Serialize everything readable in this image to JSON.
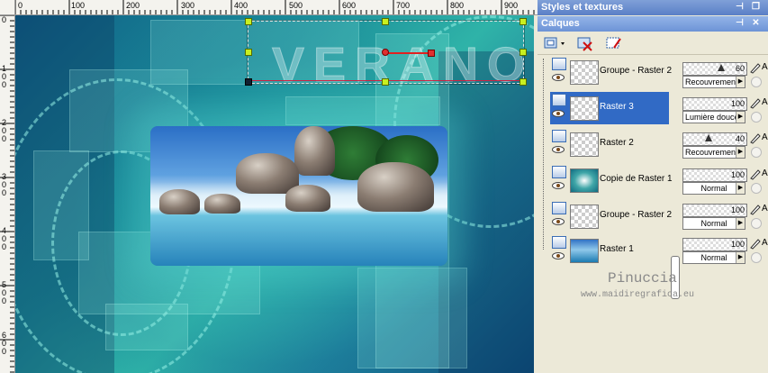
{
  "rulers": {
    "top_labels": [
      "0",
      "100",
      "200",
      "300",
      "400",
      "500",
      "600",
      "700",
      "800",
      "900"
    ],
    "left_labels": [
      "0",
      "1 0 0",
      "2 0 0",
      "3 0 0",
      "4 0 0",
      "5 0 0",
      "6 0 0",
      "7 0 0"
    ]
  },
  "canvas": {
    "watermark_text": "VERANO"
  },
  "panels": {
    "styles_title": "Styles et textures",
    "layers_title": "Calques"
  },
  "layers": [
    {
      "name": "Groupe - Raster 2",
      "thumb": "transparent",
      "selected": false
    },
    {
      "name": "Raster 3",
      "thumb": "transparent",
      "selected": true
    },
    {
      "name": "Raster 2",
      "thumb": "transparent",
      "selected": false
    },
    {
      "name": "Copie de Raster 1",
      "thumb": "teal",
      "selected": false
    },
    {
      "name": "Groupe - Raster 2",
      "thumb": "transparent",
      "selected": false
    },
    {
      "name": "Raster 1",
      "thumb": "image",
      "selected": false
    }
  ],
  "layer_props": [
    {
      "opacity": "60",
      "opacity_fraction": 0.6,
      "blend": "Recouvrement",
      "suffix": "A"
    },
    {
      "opacity": "100",
      "opacity_fraction": 1.0,
      "blend": "Lumière douce",
      "suffix": "A"
    },
    {
      "opacity": "40",
      "opacity_fraction": 0.4,
      "blend": "Recouvrement",
      "suffix": "A"
    },
    {
      "opacity": "100",
      "opacity_fraction": 1.0,
      "blend": "Normal",
      "suffix": "A"
    },
    {
      "opacity": "100",
      "opacity_fraction": 1.0,
      "blend": "Normal",
      "suffix": "A"
    },
    {
      "opacity": "100",
      "opacity_fraction": 1.0,
      "blend": "Normal",
      "suffix": "A"
    }
  ],
  "signature": {
    "name": "Pinuccia",
    "url": "www.maidiregrafica.eu"
  },
  "colors": {
    "selection": "#316ac5",
    "title_bar": "#6d93d6"
  }
}
